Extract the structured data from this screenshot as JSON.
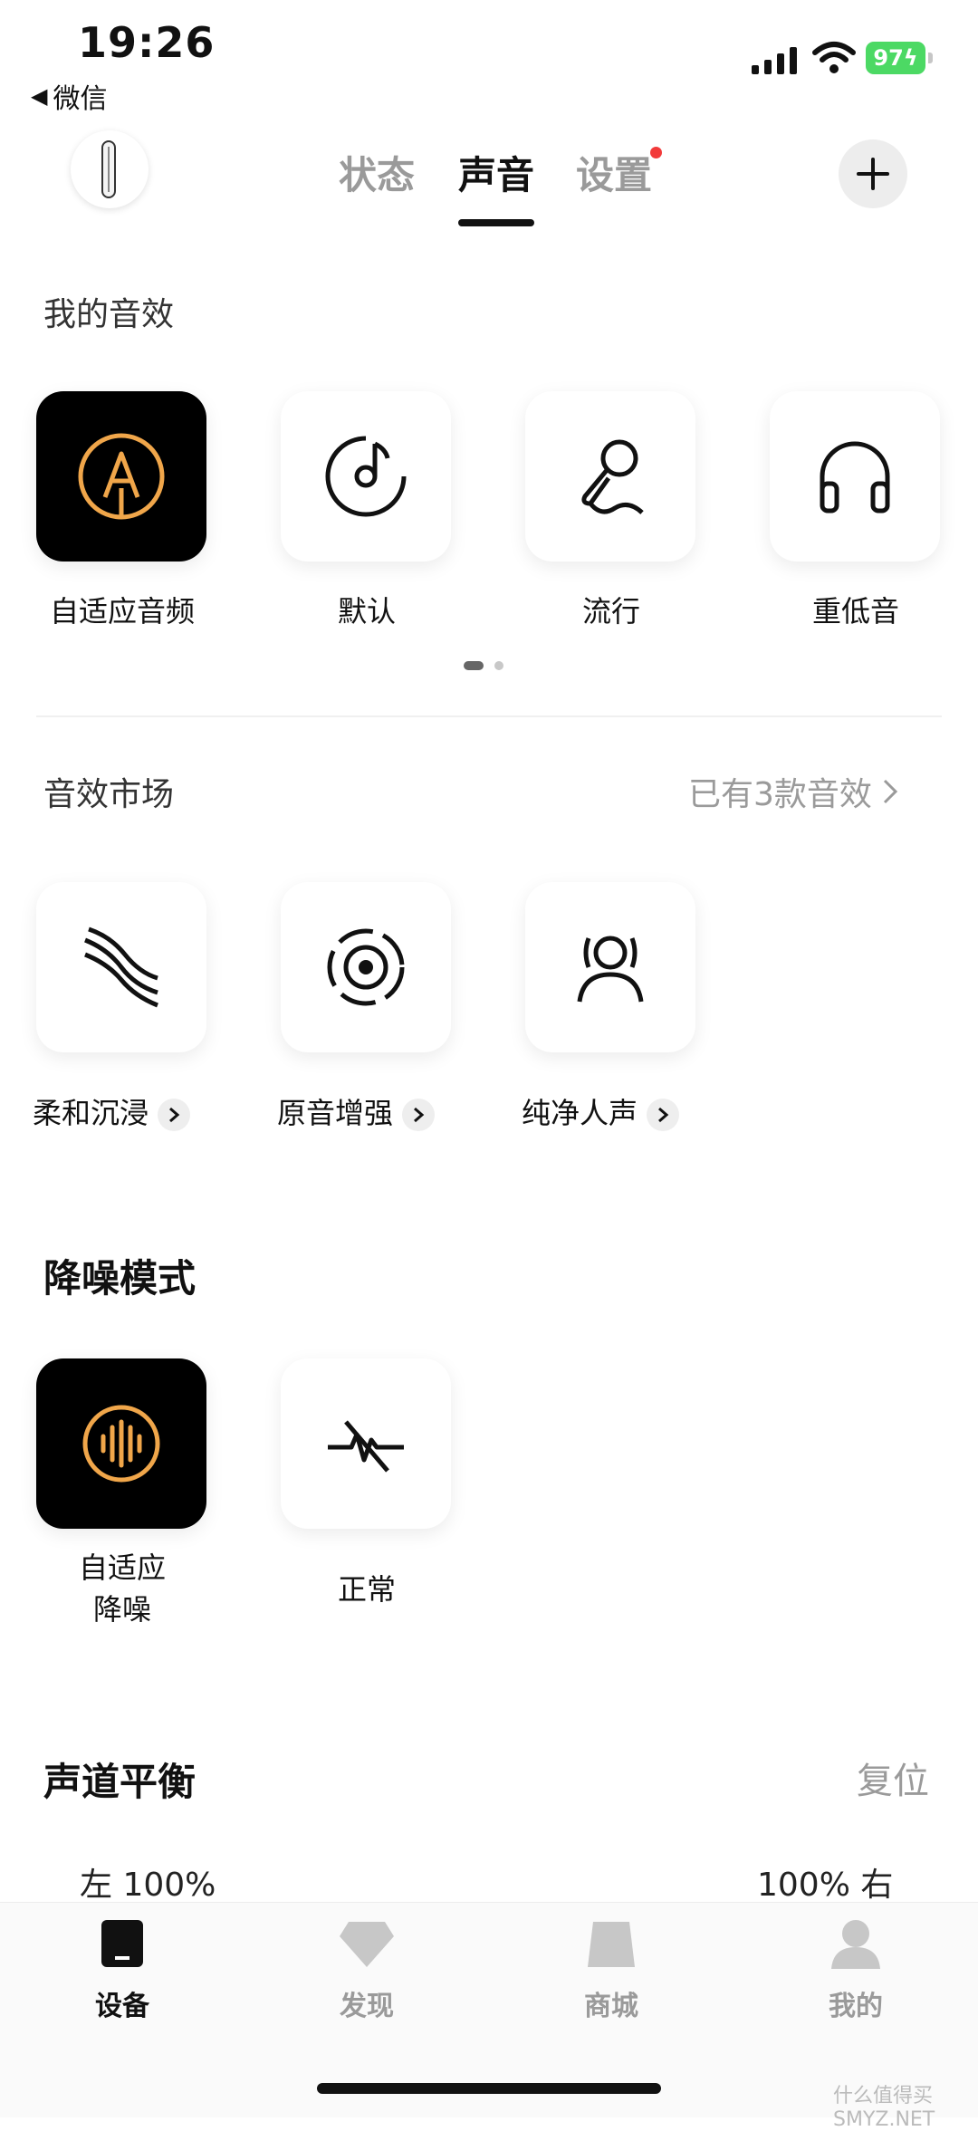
{
  "status_bar": {
    "time": "19:26",
    "back_label": "微信",
    "battery": "97"
  },
  "header": {
    "tabs": [
      {
        "label": "状态"
      },
      {
        "label": "声音"
      },
      {
        "label": "设置"
      }
    ],
    "active_tab": "声音"
  },
  "my_effects": {
    "title": "我的音效",
    "items": [
      {
        "label": "自适应音频",
        "icon": "adaptive-audio-icon",
        "selected": true
      },
      {
        "label": "默认",
        "icon": "music-disc-icon",
        "selected": false
      },
      {
        "label": "流行",
        "icon": "microphone-icon",
        "selected": false
      },
      {
        "label": "重低音",
        "icon": "headphones-icon",
        "selected": false
      }
    ],
    "page_count": 2,
    "current_page": 1
  },
  "market": {
    "title": "音效市场",
    "link_text": "已有3款音效",
    "items": [
      {
        "label": "柔和沉浸",
        "icon": "waves-icon"
      },
      {
        "label": "原音增强",
        "icon": "sound-target-icon"
      },
      {
        "label": "纯净人声",
        "icon": "vocal-person-icon"
      }
    ]
  },
  "noise_mode": {
    "title": "降噪模式",
    "items": [
      {
        "label_line1": "自适应",
        "label_line2": "降噪",
        "icon": "adaptive-anc-icon",
        "selected": true
      },
      {
        "label": "正常",
        "icon": "anc-off-icon",
        "selected": false
      }
    ]
  },
  "balance": {
    "title": "声道平衡",
    "reset": "复位",
    "left": "左 100%",
    "right": "100% 右"
  },
  "bottom_nav": [
    {
      "label": "设备",
      "icon": "device-icon",
      "active": true
    },
    {
      "label": "发现",
      "icon": "diamond-icon",
      "active": false
    },
    {
      "label": "商城",
      "icon": "shop-icon",
      "active": false
    },
    {
      "label": "我的",
      "icon": "profile-icon",
      "active": false
    }
  ],
  "watermark": "什么值得买 SMYZ.NET",
  "colors": {
    "accent_orange": "#f0a64a",
    "notification_red": "#f23a3a",
    "battery_green": "#4cd964"
  }
}
